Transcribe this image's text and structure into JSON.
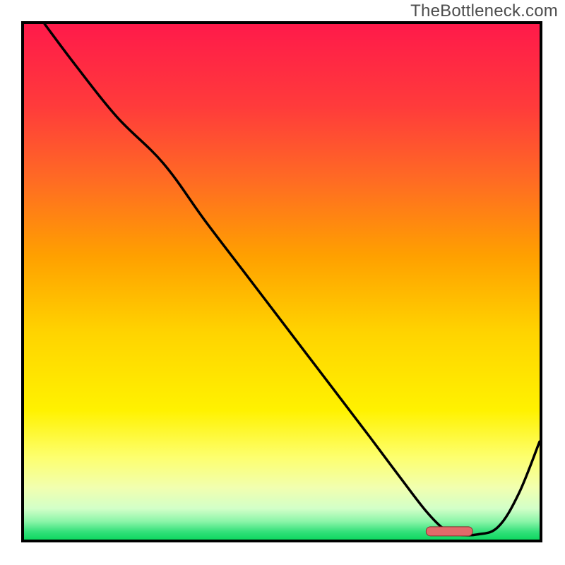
{
  "watermark": "TheBottleneck.com",
  "chart_data": {
    "type": "line",
    "title": "",
    "xlabel": "",
    "ylabel": "",
    "xlim": [
      0,
      100
    ],
    "ylim": [
      0,
      100
    ],
    "x": [
      4,
      10,
      18,
      27,
      35,
      43,
      51,
      59,
      67,
      73,
      78,
      81.5,
      84,
      88,
      92,
      96,
      100
    ],
    "values": [
      100,
      92,
      82,
      73,
      62,
      51.5,
      41,
      30.5,
      20,
      12,
      5.5,
      2,
      1,
      1,
      2.5,
      9,
      19
    ],
    "marker": {
      "x_start": 78,
      "x_end": 87,
      "y": 1.6
    },
    "gradient_stops": [
      {
        "offset": 0.0,
        "color": "#ff1a4a"
      },
      {
        "offset": 0.16,
        "color": "#ff3b3b"
      },
      {
        "offset": 0.3,
        "color": "#ff6a24"
      },
      {
        "offset": 0.45,
        "color": "#ffa000"
      },
      {
        "offset": 0.6,
        "color": "#ffd400"
      },
      {
        "offset": 0.75,
        "color": "#fff200"
      },
      {
        "offset": 0.84,
        "color": "#fdff6e"
      },
      {
        "offset": 0.9,
        "color": "#f1ffb0"
      },
      {
        "offset": 0.94,
        "color": "#d2ffc8"
      },
      {
        "offset": 0.965,
        "color": "#8bf5a8"
      },
      {
        "offset": 0.985,
        "color": "#32e07a"
      },
      {
        "offset": 1.0,
        "color": "#0fd860"
      }
    ],
    "border_color": "#000000",
    "curve_color": "#000000",
    "marker_fill": "#e26a6a",
    "marker_stroke": "#8b2f2f"
  }
}
